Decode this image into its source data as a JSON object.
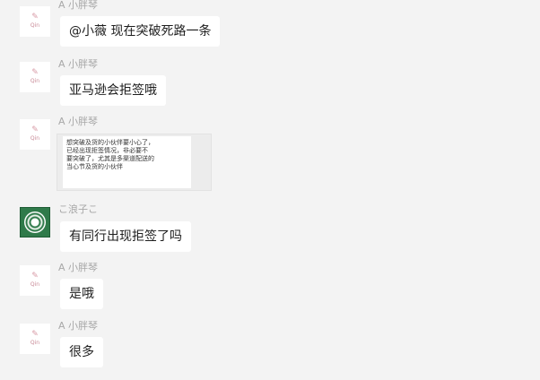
{
  "messages": [
    {
      "sender": "A 小胖琴",
      "avatar": "pink-logo",
      "avatar_mark": "✎",
      "avatar_brand": "Qin",
      "text": "@小薇 现在突破死路一条"
    },
    {
      "sender": "A 小胖琴",
      "avatar": "pink-logo",
      "avatar_mark": "✎",
      "avatar_brand": "Qin",
      "text": "亚马逊会拒签哦"
    },
    {
      "sender": "A 小胖琴",
      "avatar": "pink-logo",
      "avatar_mark": "✎",
      "avatar_brand": "Qin",
      "image_lines": [
        "想突破及货的小伙伴要小心了，",
        "已经出现拒签情况，非必要不",
        "要突破了，尤其是多渠道配送的",
        "当心节及货的小伙伴"
      ]
    },
    {
      "sender": "こ浪子こ",
      "avatar": "green-emblem",
      "text": "有同行出现拒签了吗"
    },
    {
      "sender": "A 小胖琴",
      "avatar": "pink-logo",
      "avatar_mark": "✎",
      "avatar_brand": "Qin",
      "text": "是哦"
    },
    {
      "sender": "A 小胖琴",
      "avatar": "pink-logo",
      "avatar_mark": "✎",
      "avatar_brand": "Qin",
      "text": "很多"
    }
  ]
}
